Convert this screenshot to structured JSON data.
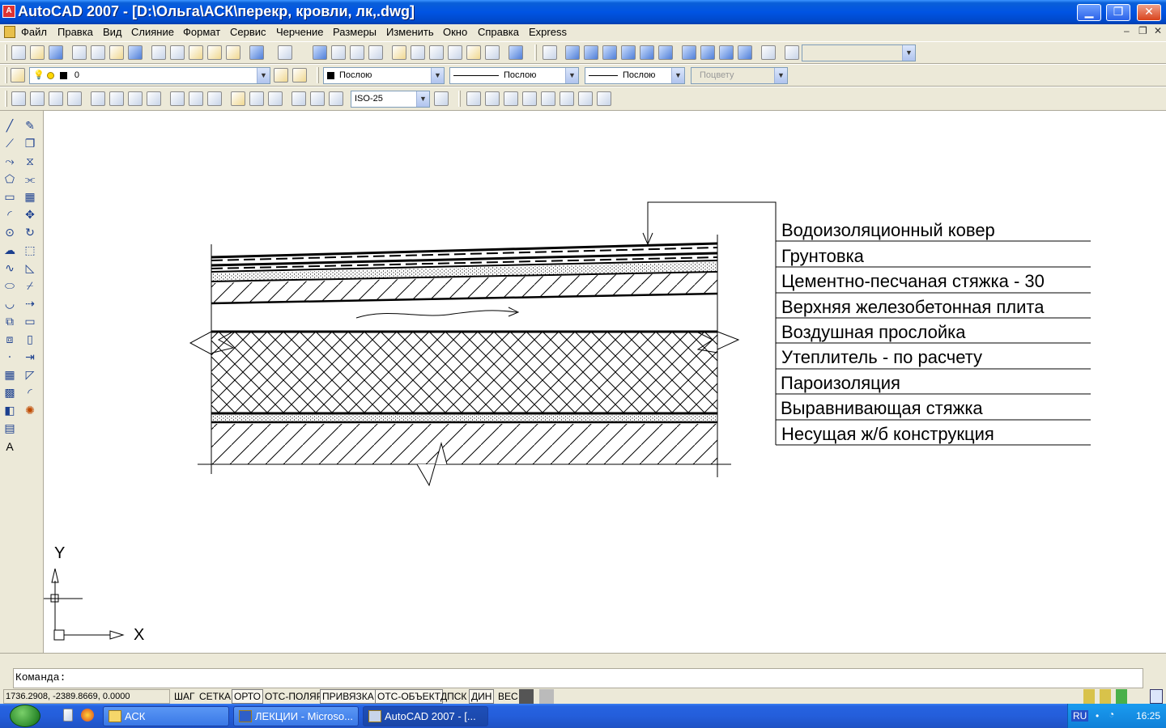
{
  "window": {
    "title": "AutoCAD 2007 - [D:\\Ольга\\АСК\\перекр, кровли, лк,.dwg]",
    "minimize": "▁",
    "maximize": "❐",
    "close": "✕"
  },
  "menu": {
    "items": [
      "Файл",
      "Правка",
      "Вид",
      "Слияние",
      "Формат",
      "Сервис",
      "Черчение",
      "Размеры",
      "Изменить",
      "Окно",
      "Справка",
      "Express"
    ],
    "mdi_controls": [
      "–",
      "❐",
      "✕"
    ]
  },
  "properties_toolbar": {
    "layer": "0",
    "color": "Послою",
    "linetype": "Послою",
    "lineweight": "Послою",
    "plotstyle": "Поцвету"
  },
  "dim_toolbar": {
    "dimstyle": "ISO-25"
  },
  "drawing": {
    "layers_legend": [
      "Водоизоляционный ковер",
      "Грунтовка",
      "Цементно-песчаная стяжка - 30",
      "Верхняя железобетонная плита",
      "Воздушная прослойка",
      "Утеплитель - по расчету",
      "Пароизоляция",
      "Выравнивающая стяжка",
      "Несущая ж/б конструкция"
    ],
    "ucs": {
      "x_label": "X",
      "y_label": "Y"
    }
  },
  "command": {
    "prompt": "Команда:"
  },
  "status": {
    "coordinates": "1736.2908, -2389.8669, 0.0000",
    "toggles": [
      "ШАГ",
      "СЕТКА",
      "ОРТО",
      "ОТС-ПОЛЯР",
      "ПРИВЯЗКА",
      "ОТС-ОБЪЕКТ",
      "ДПСК",
      "ДИН",
      "ВЕС"
    ],
    "toggles_on": [
      "ОРТО",
      "ПРИВЯЗКА",
      "ОТС-ОБЪЕКТ",
      "ДИН"
    ]
  },
  "taskbar": {
    "buttons": [
      "АСК",
      "ЛЕКЦИИ - Microso...",
      "AutoCAD 2007 - [..."
    ],
    "active": "AutoCAD 2007 - [...",
    "language": "RU",
    "clock": "16:25"
  },
  "colors": {
    "titlebar": "#0054e3",
    "canvas": "#ffffff",
    "chrome": "#ece9d8",
    "taskbar": "#245edb"
  }
}
